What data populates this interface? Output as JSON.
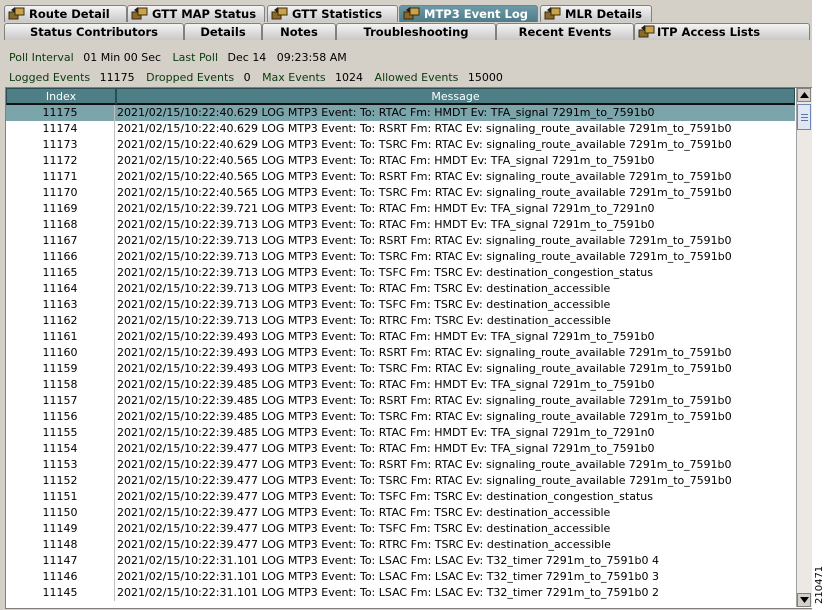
{
  "tabs_row1": [
    {
      "label": "Route Detail",
      "icon": "transfer-icon",
      "active": false
    },
    {
      "label": "GTT MAP Status",
      "icon": "transfer-icon",
      "active": false
    },
    {
      "label": "GTT Statistics",
      "icon": "transfer-icon",
      "active": false
    },
    {
      "label": "MTP3 Event Log",
      "icon": "transfer-icon",
      "active": true
    },
    {
      "label": "MLR Details",
      "icon": "transfer-icon",
      "active": false
    }
  ],
  "tabs_row2": [
    {
      "label": "Status Contributors",
      "icon": null
    },
    {
      "label": "Details",
      "icon": null
    },
    {
      "label": "Notes",
      "icon": null
    },
    {
      "label": "Troubleshooting",
      "icon": null
    },
    {
      "label": "Recent Events",
      "icon": null
    },
    {
      "label": "ITP Access Lists",
      "icon": "transfer-icon"
    }
  ],
  "poll": {
    "interval_label": "Poll Interval",
    "interval_value": "01 Min 00 Sec",
    "last_label": "Last Poll",
    "last_value": "Dec 14   09:23:58 AM"
  },
  "stats": {
    "logged_label": "Logged Events",
    "logged_value": "11175",
    "dropped_label": "Dropped Events",
    "dropped_value": "0",
    "max_label": "Max Events",
    "max_value": "1024",
    "allowed_label": "Allowed Events",
    "allowed_value": "15000"
  },
  "table": {
    "headers": [
      "Index",
      "Message"
    ],
    "selected_index": 0,
    "rows": [
      [
        "11175",
        "2021/02/15/10:22:40.629 LOG MTP3 Event: To: RTAC Fm: HMDT Ev: TFA_signal 7291m_to_7591b0"
      ],
      [
        "11174",
        "2021/02/15/10:22:40.629 LOG MTP3 Event: To: RSRT Fm: RTAC Ev: signaling_route_available 7291m_to_7591b0"
      ],
      [
        "11173",
        "2021/02/15/10:22:40.629 LOG MTP3 Event: To: TSRC Fm: RTAC Ev: signaling_route_available 7291m_to_7591b0"
      ],
      [
        "11172",
        "2021/02/15/10:22:40.565 LOG MTP3 Event: To: RTAC Fm: HMDT Ev: TFA_signal 7291m_to_7591b0"
      ],
      [
        "11171",
        "2021/02/15/10:22:40.565 LOG MTP3 Event: To: RSRT Fm: RTAC Ev: signaling_route_available 7291m_to_7591b0"
      ],
      [
        "11170",
        "2021/02/15/10:22:40.565 LOG MTP3 Event: To: TSRC Fm: RTAC Ev: signaling_route_available 7291m_to_7591b0"
      ],
      [
        "11169",
        "2021/02/15/10:22:39.721 LOG MTP3 Event: To: RTAC Fm: HMDT Ev: TFA_signal 7291m_to_7291n0"
      ],
      [
        "11168",
        "2021/02/15/10:22:39.713 LOG MTP3 Event: To: RTAC Fm: HMDT Ev: TFA_signal 7291m_to_7591b0"
      ],
      [
        "11167",
        "2021/02/15/10:22:39.713 LOG MTP3 Event: To: RSRT Fm: RTAC Ev: signaling_route_available 7291m_to_7591b0"
      ],
      [
        "11166",
        "2021/02/15/10:22:39.713 LOG MTP3 Event: To: TSRC Fm: RTAC Ev: signaling_route_available 7291m_to_7591b0"
      ],
      [
        "11165",
        "2021/02/15/10:22:39.713 LOG MTP3 Event: To: TSFC Fm: TSRC Ev: destination_congestion_status"
      ],
      [
        "11164",
        "2021/02/15/10:22:39.713 LOG MTP3 Event: To: RTAC Fm: TSRC Ev: destination_accessible"
      ],
      [
        "11163",
        "2021/02/15/10:22:39.713 LOG MTP3 Event: To: TSFC Fm: TSRC Ev: destination_accessible"
      ],
      [
        "11162",
        "2021/02/15/10:22:39.713 LOG MTP3 Event: To: RTRC Fm: TSRC Ev: destination_accessible"
      ],
      [
        "11161",
        "2021/02/15/10:22:39.493 LOG MTP3 Event: To: RTAC Fm: HMDT Ev: TFA_signal 7291m_to_7591b0"
      ],
      [
        "11160",
        "2021/02/15/10:22:39.493 LOG MTP3 Event: To: RSRT Fm: RTAC Ev: signaling_route_available 7291m_to_7591b0"
      ],
      [
        "11159",
        "2021/02/15/10:22:39.493 LOG MTP3 Event: To: TSRC Fm: RTAC Ev: signaling_route_available 7291m_to_7591b0"
      ],
      [
        "11158",
        "2021/02/15/10:22:39.485 LOG MTP3 Event: To: RTAC Fm: HMDT Ev: TFA_signal 7291m_to_7591b0"
      ],
      [
        "11157",
        "2021/02/15/10:22:39.485 LOG MTP3 Event: To: RSRT Fm: RTAC Ev: signaling_route_available 7291m_to_7591b0"
      ],
      [
        "11156",
        "2021/02/15/10:22:39.485 LOG MTP3 Event: To: TSRC Fm: RTAC Ev: signaling_route_available 7291m_to_7591b0"
      ],
      [
        "11155",
        "2021/02/15/10:22:39.485 LOG MTP3 Event: To: RTAC Fm: HMDT Ev: TFA_signal 7291m_to_7291n0"
      ],
      [
        "11154",
        "2021/02/15/10:22:39.477 LOG MTP3 Event: To: RTAC Fm: HMDT Ev: TFA_signal 7291m_to_7591b0"
      ],
      [
        "11153",
        "2021/02/15/10:22:39.477 LOG MTP3 Event: To: RSRT Fm: RTAC Ev: signaling_route_available 7291m_to_7591b0"
      ],
      [
        "11152",
        "2021/02/15/10:22:39.477 LOG MTP3 Event: To: TSRC Fm: RTAC Ev: signaling_route_available 7291m_to_7591b0"
      ],
      [
        "11151",
        "2021/02/15/10:22:39.477 LOG MTP3 Event: To: TSFC Fm: TSRC Ev: destination_congestion_status"
      ],
      [
        "11150",
        "2021/02/15/10:22:39.477 LOG MTP3 Event: To: RTAC Fm: TSRC Ev: destination_accessible"
      ],
      [
        "11149",
        "2021/02/15/10:22:39.477 LOG MTP3 Event: To: TSFC Fm: TSRC Ev: destination_accessible"
      ],
      [
        "11148",
        "2021/02/15/10:22:39.477 LOG MTP3 Event: To: RTRC Fm: TSRC Ev: destination_accessible"
      ],
      [
        "11147",
        "2021/02/15/10:22:31.101 LOG MTP3 Event: To: LSAC Fm: LSAC Ev: T32_timer 7291m_to_7591b0 4"
      ],
      [
        "11146",
        "2021/02/15/10:22:31.101 LOG MTP3 Event: To: LSAC Fm: LSAC Ev: T32_timer 7291m_to_7591b0 3"
      ],
      [
        "11145",
        "2021/02/15/10:22:31.101 LOG MTP3 Event: To: LSAC Fm: LSAC Ev: T32_timer 7291m_to_7591b0 2"
      ]
    ]
  },
  "figure_id": "210471",
  "colors": {
    "active_tab": "#5a8893",
    "header": "#4e7f86",
    "selected_row": "#7ba5ab",
    "panel": "#d4d0c8"
  }
}
